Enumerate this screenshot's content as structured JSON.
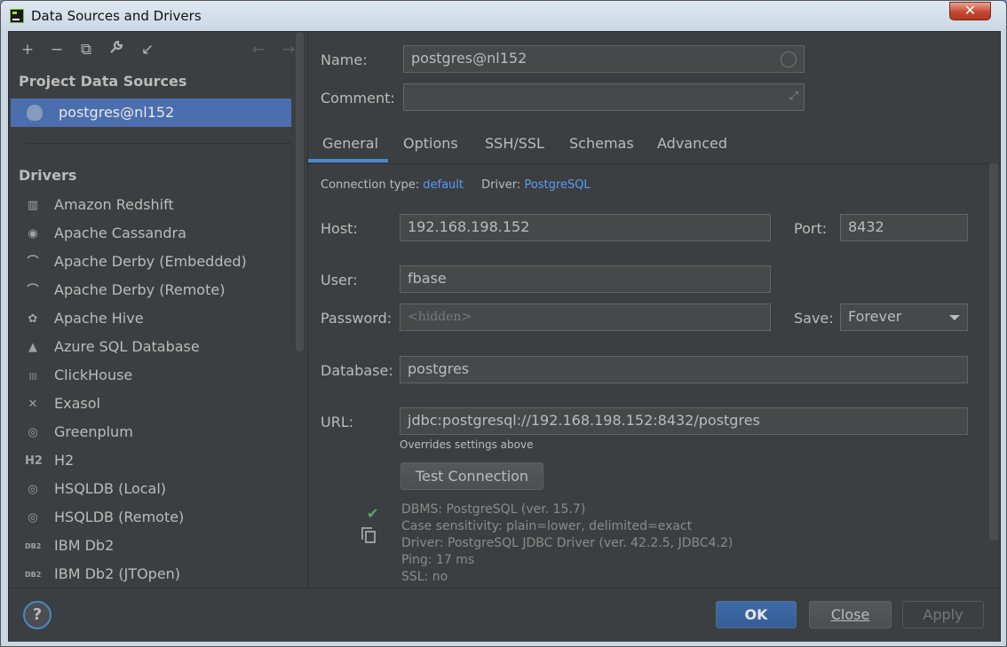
{
  "window": {
    "title": "Data Sources and Drivers",
    "close_glyph": "✕"
  },
  "sidebar": {
    "toolbar": {
      "add": "+",
      "remove": "−",
      "copy": "⧉",
      "wrench": "🔧",
      "import": "↙",
      "back": "←",
      "forward": "→"
    },
    "project_header": "Project Data Sources",
    "data_source": "postgres@nl152",
    "drivers_header": "Drivers",
    "drivers": [
      {
        "label": "Amazon Redshift",
        "icon": "redshift-icon",
        "glyph": "▥"
      },
      {
        "label": "Apache Cassandra",
        "icon": "cassandra-icon",
        "glyph": "◉"
      },
      {
        "label": "Apache Derby (Embedded)",
        "icon": "derby-icon",
        "glyph": "⌒"
      },
      {
        "label": "Apache Derby (Remote)",
        "icon": "derby-icon",
        "glyph": "⌒"
      },
      {
        "label": "Apache Hive",
        "icon": "hive-icon",
        "glyph": "✿"
      },
      {
        "label": "Azure SQL Database",
        "icon": "azure-icon",
        "glyph": "▲"
      },
      {
        "label": "ClickHouse",
        "icon": "clickhouse-icon",
        "glyph": "|||"
      },
      {
        "label": "Exasol",
        "icon": "exasol-icon",
        "glyph": "✕"
      },
      {
        "label": "Greenplum",
        "icon": "greenplum-icon",
        "glyph": "◎"
      },
      {
        "label": "H2",
        "icon": "h2-icon",
        "glyph": "H2"
      },
      {
        "label": "HSQLDB (Local)",
        "icon": "hsqldb-icon",
        "glyph": "◎"
      },
      {
        "label": "HSQLDB (Remote)",
        "icon": "hsqldb-icon",
        "glyph": "◎"
      },
      {
        "label": "IBM Db2",
        "icon": "ibm-db2-icon",
        "glyph": "DB2"
      },
      {
        "label": "IBM Db2 (JTOpen)",
        "icon": "ibm-db2-icon",
        "glyph": "DB2"
      }
    ]
  },
  "main": {
    "name_label": "Name:",
    "name_value": "postgres@nl152",
    "comment_label": "Comment:",
    "comment_value": "",
    "tabs": [
      "General",
      "Options",
      "SSH/SSL",
      "Schemas",
      "Advanced"
    ],
    "connection_type_label": "Connection type:",
    "connection_type_value": "default",
    "driver_label": "Driver:",
    "driver_value": "PostgreSQL",
    "host_label": "Host:",
    "host_value": "192.168.198.152",
    "port_label": "Port:",
    "port_value": "8432",
    "user_label": "User:",
    "user_value": "fbase",
    "password_label": "Password:",
    "password_placeholder": "<hidden>",
    "save_label": "Save:",
    "save_value": "Forever",
    "database_label": "Database:",
    "database_value": "postgres",
    "url_label": "URL:",
    "url_value": "jdbc:postgresql://192.168.198.152:8432/postgres",
    "url_note": "Overrides settings above",
    "test_button": "Test Connection",
    "status": [
      "DBMS: PostgreSQL (ver. 15.7)",
      "Case sensitivity: plain=lower, delimited=exact",
      "Driver: PostgreSQL JDBC Driver (ver. 42.2.5, JDBC4.2)",
      "Ping: 17 ms",
      "SSL: no"
    ],
    "check_glyph": "✔"
  },
  "footer": {
    "help": "?",
    "ok": "OK",
    "close": "Close",
    "apply": "Apply"
  },
  "colors": {
    "accent": "#4a88c7",
    "selection": "#4b6eaf",
    "link": "#589df6",
    "background": "#3c3f41"
  }
}
